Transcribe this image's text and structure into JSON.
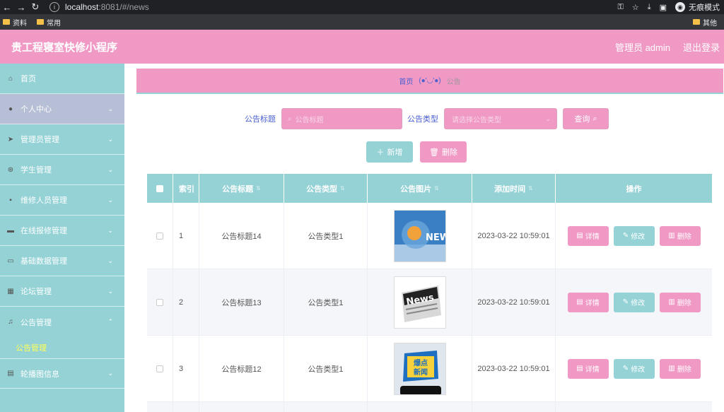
{
  "browser": {
    "url_host": "localhost",
    "url_port_path": ":8081/#/news",
    "incognito_label": "无痕模式",
    "bookmarks": [
      "资料",
      "常用"
    ],
    "bookmark_other": "其他"
  },
  "header": {
    "title": "贵工程寝室快修小程序",
    "user_label": "管理员 admin",
    "logout_label": "退出登录"
  },
  "sidebar": {
    "items": [
      {
        "label": "首页",
        "icon": "home-icon"
      },
      {
        "label": "个人中心",
        "icon": "user-icon"
      },
      {
        "label": "管理员管理",
        "icon": "send-icon"
      },
      {
        "label": "学生管理",
        "icon": "help-icon"
      },
      {
        "label": "维修人员管理",
        "icon": "bag-icon"
      },
      {
        "label": "在线报修管理",
        "icon": "message-icon"
      },
      {
        "label": "基础数据管理",
        "icon": "monitor-icon"
      },
      {
        "label": "论坛管理",
        "icon": "grid-icon"
      },
      {
        "label": "公告管理",
        "icon": "mic-icon"
      },
      {
        "label": "轮播图信息",
        "icon": "notebook-icon"
      }
    ],
    "submenu_label": "公告管理"
  },
  "breadcrumb": {
    "home": "首页",
    "face": "(●'◡'●)",
    "current": "公告"
  },
  "search": {
    "title_label": "公告标题",
    "title_placeholder": "公告标题",
    "type_label": "公告类型",
    "type_placeholder": "请选择公告类型",
    "query_label": "查询"
  },
  "actions": {
    "add_label": "新增",
    "delete_label": "删除"
  },
  "table": {
    "headers": {
      "index": "索引",
      "title": "公告标题",
      "type": "公告类型",
      "image": "公告图片",
      "time": "添加时间",
      "ops": "操作"
    },
    "op_labels": {
      "detail": "详情",
      "edit": "修改",
      "delete": "删除"
    },
    "rows": [
      {
        "index": "1",
        "title": "公告标题14",
        "type": "公告类型1",
        "time": "2023-03-22 10:59:01"
      },
      {
        "index": "2",
        "title": "公告标题13",
        "type": "公告类型1",
        "time": "2023-03-22 10:59:01"
      },
      {
        "index": "3",
        "title": "公告标题12",
        "type": "公告类型1",
        "time": "2023-03-22 10:59:01"
      }
    ]
  },
  "colors": {
    "pink": "#f099c5",
    "teal": "#94d2d6",
    "link_blue": "#4a5fd1"
  }
}
